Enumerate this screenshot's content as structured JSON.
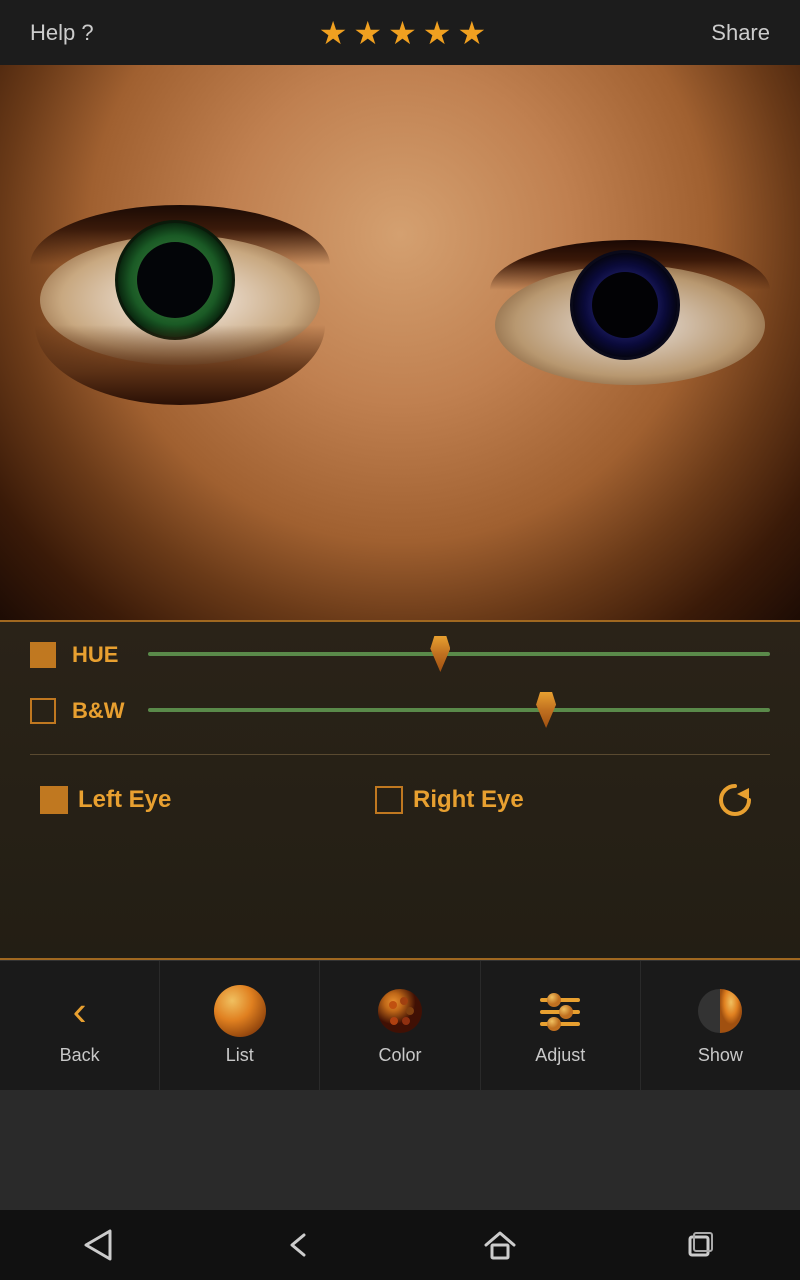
{
  "header": {
    "help_label": "Help ?",
    "share_label": "Share",
    "stars": [
      "★",
      "★",
      "★",
      "★",
      "★"
    ]
  },
  "controls": {
    "hue_label": "HUE",
    "bw_label": "B&W",
    "hue_value": 47,
    "bw_value": 64,
    "left_eye_label": "Left Eye",
    "right_eye_label": "Right Eye"
  },
  "nav": {
    "back_label": "Back",
    "list_label": "List",
    "color_label": "Color",
    "adjust_label": "Adjust",
    "show_label": "Show"
  }
}
